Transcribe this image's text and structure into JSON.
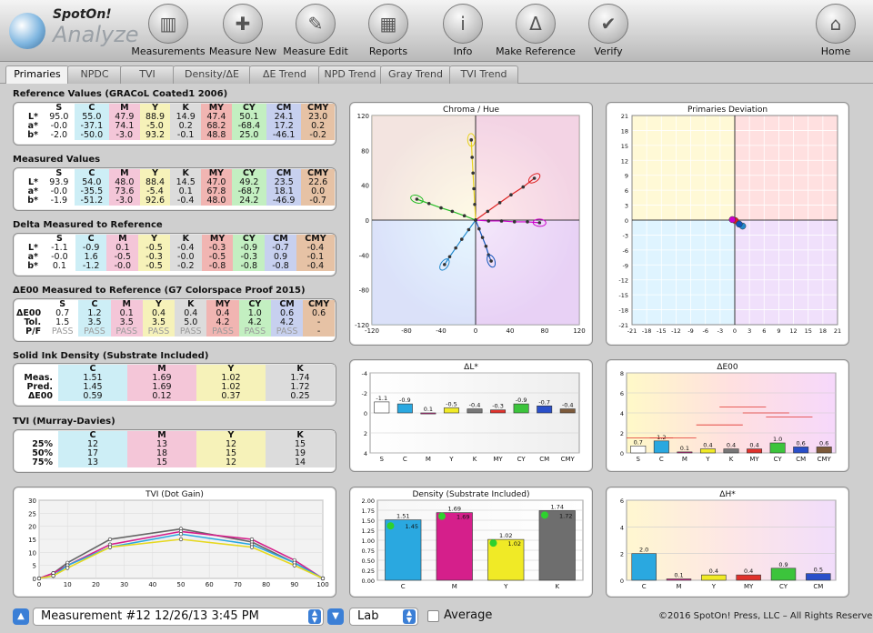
{
  "logo": {
    "line1": "SpotOn!",
    "line2": "Analyze"
  },
  "toolbar": [
    {
      "label": "Measurements",
      "icon": "measurements-icon",
      "glyph": "▥"
    },
    {
      "label": "Measure New",
      "icon": "measure-new-icon",
      "glyph": "✚"
    },
    {
      "label": "Measure Edit",
      "icon": "measure-edit-icon",
      "glyph": "✎"
    },
    {
      "label": "Reports",
      "icon": "reports-icon",
      "glyph": "▦"
    },
    {
      "label": "Info",
      "icon": "info-icon",
      "glyph": "i"
    },
    {
      "label": "Make Reference",
      "icon": "make-reference-icon",
      "glyph": "Δ"
    },
    {
      "label": "Verify",
      "icon": "verify-icon",
      "glyph": "✔"
    },
    {
      "label": "Home",
      "icon": "home-icon",
      "glyph": "⌂"
    }
  ],
  "tabs": [
    "Primaries",
    "NPDC",
    "TVI",
    "Density/ΔE",
    "ΔE Trend",
    "NPD Trend",
    "Gray Trend",
    "TVI Trend"
  ],
  "sections": {
    "ref": "Reference Values (GRACoL Coated1 2006)",
    "meas": "Measured Values",
    "delta": "Delta Measured to Reference",
    "de00": "ΔE00 Measured to Reference (G7 Colorspace Proof 2015)",
    "sid": "Solid Ink Density (Substrate Included)",
    "tvi": "TVI (Murray-Davies)"
  },
  "lab_cols": [
    "S",
    "C",
    "M",
    "Y",
    "K",
    "MY",
    "CY",
    "CM",
    "CMY"
  ],
  "ref_rows": [
    {
      "h": "L*",
      "v": [
        "95.0",
        "55.0",
        "47.9",
        "88.9",
        "14.9",
        "47.4",
        "50.1",
        "24.1",
        "23.0"
      ]
    },
    {
      "h": "a*",
      "v": [
        "-0.0",
        "-37.1",
        "74.1",
        "-5.0",
        "0.2",
        "68.2",
        "-68.4",
        "17.2",
        "0.2"
      ]
    },
    {
      "h": "b*",
      "v": [
        "-2.0",
        "-50.0",
        "-3.0",
        "93.2",
        "-0.1",
        "48.8",
        "25.0",
        "-46.1",
        "-0.2"
      ]
    }
  ],
  "meas_rows": [
    {
      "h": "L*",
      "v": [
        "93.9",
        "54.0",
        "48.0",
        "88.4",
        "14.5",
        "47.0",
        "49.2",
        "23.5",
        "22.6"
      ]
    },
    {
      "h": "a*",
      "v": [
        "-0.0",
        "-35.5",
        "73.6",
        "-5.4",
        "0.1",
        "67.8",
        "-68.7",
        "18.1",
        "0.0"
      ]
    },
    {
      "h": "b*",
      "v": [
        "-1.9",
        "-51.2",
        "-3.0",
        "92.6",
        "-0.4",
        "48.0",
        "24.2",
        "-46.9",
        "-0.7"
      ]
    }
  ],
  "delta_rows": [
    {
      "h": "L*",
      "v": [
        "-1.1",
        "-0.9",
        "0.1",
        "-0.5",
        "-0.4",
        "-0.3",
        "-0.9",
        "-0.7",
        "-0.4"
      ]
    },
    {
      "h": "a*",
      "v": [
        "-0.0",
        "1.6",
        "-0.5",
        "-0.3",
        "-0.0",
        "-0.5",
        "-0.3",
        "0.9",
        "-0.1"
      ]
    },
    {
      "h": "b*",
      "v": [
        "0.1",
        "-1.2",
        "-0.0",
        "-0.5",
        "-0.2",
        "-0.8",
        "-0.8",
        "-0.8",
        "-0.4"
      ]
    }
  ],
  "de00_rows": [
    {
      "h": "ΔE00",
      "v": [
        "0.7",
        "1.2",
        "0.1",
        "0.4",
        "0.4",
        "0.4",
        "1.0",
        "0.6",
        "0.6"
      ]
    },
    {
      "h": "Tol.",
      "v": [
        "1.5",
        "3.5",
        "3.5",
        "3.5",
        "5.0",
        "4.2",
        "4.2",
        "4.2",
        "-"
      ]
    },
    {
      "h": "P/F",
      "v": [
        "PASS",
        "PASS",
        "PASS",
        "PASS",
        "PASS",
        "PASS",
        "PASS",
        "PASS",
        "-"
      ]
    }
  ],
  "ink_cols": [
    "C",
    "M",
    "Y",
    "K"
  ],
  "sid_rows": [
    {
      "h": "Meas.",
      "v": [
        "1.51",
        "1.69",
        "1.02",
        "1.74"
      ]
    },
    {
      "h": "Pred.",
      "v": [
        "1.45",
        "1.69",
        "1.02",
        "1.72"
      ]
    },
    {
      "h": "ΔE00",
      "v": [
        "0.59",
        "0.12",
        "0.37",
        "0.25"
      ]
    }
  ],
  "tvi_rows": [
    {
      "h": "25%",
      "v": [
        "12",
        "13",
        "12",
        "15"
      ]
    },
    {
      "h": "50%",
      "v": [
        "17",
        "18",
        "15",
        "19"
      ]
    },
    {
      "h": "75%",
      "v": [
        "13",
        "15",
        "12",
        "14"
      ]
    }
  ],
  "chart_data": [
    {
      "type": "scatter",
      "title": "Chroma / Hue",
      "xlim": [
        -120,
        120
      ],
      "ylim": [
        -120,
        120
      ],
      "xticks": [
        "-120",
        "-80",
        "-40",
        "0",
        "40",
        "80",
        "120"
      ],
      "yticks": [
        "120",
        "80",
        "40",
        "0",
        "-40",
        "-80",
        "-120"
      ],
      "series": [
        {
          "color": "#e8d21e",
          "x": [
            0,
            -1,
            -2,
            -3,
            -4,
            -5
          ],
          "y": [
            0,
            18,
            36,
            54,
            72,
            92
          ]
        },
        {
          "color": "#d22",
          "x": [
            0,
            14,
            28,
            41,
            55,
            68
          ],
          "y": [
            0,
            10,
            20,
            29,
            38,
            48
          ]
        },
        {
          "color": "#c0c",
          "x": [
            0,
            15,
            30,
            45,
            60,
            74
          ],
          "y": [
            0,
            -1,
            -1,
            -2,
            -2,
            -3
          ]
        },
        {
          "color": "#15b",
          "x": [
            0,
            4,
            8,
            12,
            15,
            18
          ],
          "y": [
            0,
            -10,
            -20,
            -30,
            -40,
            -47
          ]
        },
        {
          "color": "#28c",
          "x": [
            0,
            -8,
            -16,
            -23,
            -30,
            -36
          ],
          "y": [
            0,
            -11,
            -22,
            -32,
            -42,
            -51
          ]
        },
        {
          "color": "#2b2",
          "x": [
            0,
            -13,
            -27,
            -40,
            -54,
            -68
          ],
          "y": [
            0,
            5,
            10,
            14,
            19,
            24
          ]
        }
      ]
    },
    {
      "type": "scatter",
      "title": "Primaries Deviation",
      "xlim": [
        -21,
        21
      ],
      "ylim": [
        -21,
        21
      ],
      "xticks": [
        "-21",
        "-18",
        "-15",
        "-12",
        "-9",
        "-6",
        "-3",
        "0",
        "3",
        "6",
        "9",
        "12",
        "15",
        "18",
        "21"
      ],
      "yticks": [
        "21",
        "18",
        "15",
        "12",
        "9",
        "6",
        "3",
        "0",
        "-3",
        "-6",
        "-9",
        "-12",
        "-15",
        "-18",
        "-21"
      ],
      "points": [
        {
          "x": 0.1,
          "y": -0.1,
          "color": "#d22"
        },
        {
          "x": -0.5,
          "y": 0.1,
          "color": "#c0c"
        },
        {
          "x": 1.6,
          "y": -1.2,
          "color": "#28c"
        },
        {
          "x": 0.9,
          "y": -0.8,
          "color": "#15b"
        }
      ]
    },
    {
      "type": "bar",
      "title": "ΔL*",
      "categories": [
        "S",
        "C",
        "M",
        "Y",
        "K",
        "MY",
        "CY",
        "CM",
        "CMY"
      ],
      "values": [
        -1.1,
        -0.9,
        0.1,
        -0.5,
        -0.4,
        -0.3,
        -0.9,
        -0.7,
        -0.4
      ],
      "labels": [
        "-1.1",
        "-0.9",
        "0.1",
        "-0.5",
        "-0.4",
        "-0.3",
        "-0.9",
        "-0.7",
        "-0.4"
      ],
      "ylim": [
        -4,
        4
      ],
      "yticks": [
        "-4",
        "-2",
        "0",
        "2",
        "4"
      ],
      "colors": [
        "#fff",
        "#2aa8e0",
        "#d51f8b",
        "#f0ea26",
        "#777",
        "#e0322c",
        "#3cc43c",
        "#2a4fc9",
        "#7d5a3a"
      ]
    },
    {
      "type": "bar",
      "title": "ΔE00",
      "categories": [
        "S",
        "C",
        "M",
        "Y",
        "K",
        "MY",
        "CY",
        "CM",
        "CMY"
      ],
      "values": [
        0.7,
        1.2,
        0.1,
        0.4,
        0.4,
        0.4,
        1.0,
        0.6,
        0.6
      ],
      "labels": [
        "0.7",
        "1.2",
        "0.1",
        "0.4",
        "0.4",
        "0.4",
        "1.0",
        "0.6",
        "0.6"
      ],
      "ylim": [
        0,
        8
      ],
      "yticks": [
        "8",
        "6",
        "4",
        "2",
        "0"
      ],
      "colors": [
        "#fff",
        "#2aa8e0",
        "#d51f8b",
        "#f0ea26",
        "#777",
        "#e0322c",
        "#3cc43c",
        "#2a4fc9",
        "#7d5a3a"
      ]
    },
    {
      "type": "line",
      "title": "TVI (Dot Gain)",
      "xlim": [
        0,
        100
      ],
      "ylim": [
        0,
        30
      ],
      "xticks": [
        "0",
        "10",
        "20",
        "30",
        "40",
        "50",
        "60",
        "70",
        "80",
        "90",
        "100"
      ],
      "yticks": [
        "30",
        "25",
        "20",
        "15",
        "10",
        "5",
        "0"
      ],
      "series": [
        {
          "color": "#666",
          "x": [
            0,
            5,
            10,
            25,
            50,
            75,
            90,
            100
          ],
          "y": [
            0,
            2,
            6,
            15,
            19,
            14,
            6,
            0
          ]
        },
        {
          "color": "#d51f8b",
          "x": [
            0,
            5,
            10,
            25,
            50,
            75,
            90,
            100
          ],
          "y": [
            0,
            2,
            5,
            13,
            18,
            15,
            7,
            0
          ]
        },
        {
          "color": "#2aa8e0",
          "x": [
            0,
            5,
            10,
            25,
            50,
            75,
            90,
            100
          ],
          "y": [
            0,
            1,
            5,
            12,
            17,
            13,
            6,
            0
          ]
        },
        {
          "color": "#e6d820",
          "x": [
            0,
            5,
            10,
            25,
            50,
            75,
            90,
            100
          ],
          "y": [
            0,
            1,
            4,
            12,
            15,
            12,
            5,
            0
          ]
        }
      ]
    },
    {
      "type": "bar",
      "title": "Density (Substrate Included)",
      "categories": [
        "C",
        "M",
        "Y",
        "K"
      ],
      "values": [
        1.51,
        1.69,
        1.02,
        1.74
      ],
      "predicted": [
        1.45,
        1.69,
        1.02,
        1.72
      ],
      "labels": [
        "1.51",
        "1.69",
        "1.02",
        "1.74"
      ],
      "pred_labels": [
        "1.45",
        "1.69",
        "1.02",
        "1.72"
      ],
      "ylim": [
        0,
        2
      ],
      "yticks": [
        "2.00",
        "1.75",
        "1.50",
        "1.25",
        "1.00",
        "0.75",
        "0.50",
        "0.25",
        "0.00"
      ],
      "colors": [
        "#2aa8e0",
        "#d51f8b",
        "#f0ea26",
        "#6e6e6e"
      ]
    },
    {
      "type": "bar",
      "title": "ΔH*",
      "categories": [
        "C",
        "M",
        "Y",
        "MY",
        "CY",
        "CM"
      ],
      "values": [
        2.0,
        0.1,
        0.4,
        0.4,
        0.9,
        0.5
      ],
      "labels": [
        "2.0",
        "0.1",
        "0.4",
        "0.4",
        "0.9",
        "0.5"
      ],
      "ylim": [
        0,
        6
      ],
      "yticks": [
        "6",
        "4",
        "2",
        "0"
      ],
      "colors": [
        "#2aa8e0",
        "#d51f8b",
        "#f0ea26",
        "#e0322c",
        "#3cc43c",
        "#2a4fc9"
      ]
    }
  ],
  "bottom": {
    "measurement": "Measurement #12 12/26/13 3:45 PM",
    "space": "Lab",
    "average": "Average",
    "copyright": "©2016 SpotOn! Press, LLC – All Rights Reserved"
  }
}
